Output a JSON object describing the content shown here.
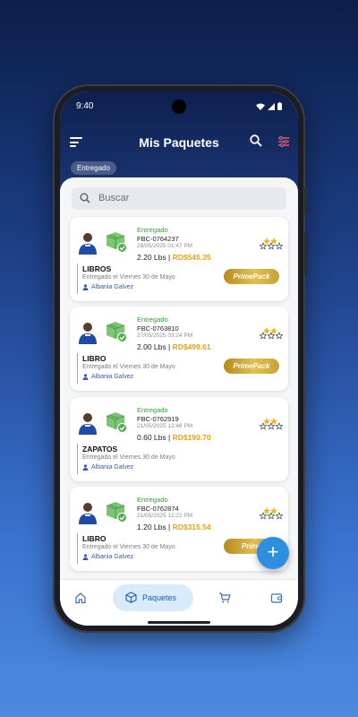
{
  "status_bar": {
    "time": "9:40"
  },
  "app_bar": {
    "title": "Mis Paquetes"
  },
  "filter_chip": {
    "label": "Entregado"
  },
  "search": {
    "placeholder": "Buscar"
  },
  "packages": [
    {
      "status": "Entregado",
      "code": "FBC-0764237",
      "date": "28/05/2025 01:47 PM",
      "weight": "2.20 Lbs",
      "price": "RD$545.35",
      "category": "LIBROS",
      "delivered_text": "Entregado el Viernes 30 de Mayo",
      "recipient": "Albania Galvez",
      "badge": "PrimePack"
    },
    {
      "status": "Entregado",
      "code": "FBC-0763810",
      "date": "27/05/2025 03:24 PM",
      "weight": "2.00 Lbs",
      "price": "RD$499.61",
      "category": "LIBRO",
      "delivered_text": "Entregado el Viernes 30 de Mayo",
      "recipient": "Albania Galvez",
      "badge": "PrimePack"
    },
    {
      "status": "Entregado",
      "code": "FBC-0762919",
      "date": "21/05/2025 12:46 PM",
      "weight": "0.60 Lbs",
      "price": "RD$190.70",
      "category": "ZAPATOS",
      "delivered_text": "Entregado el Viernes 30 de Mayo",
      "recipient": "Albania Galvez",
      "badge": ""
    },
    {
      "status": "Entregado",
      "code": "FBC-0762874",
      "date": "21/05/2025 12:22 PM",
      "weight": "1.20 Lbs",
      "price": "RD$315.54",
      "category": "LIBRO",
      "delivered_text": "Entregado el Viernes 30 de Mayo",
      "recipient": "Albania Galvez",
      "badge": "Prime"
    }
  ],
  "bottom_nav": {
    "items": [
      {
        "icon": "home-icon",
        "label": ""
      },
      {
        "icon": "package-icon",
        "label": "Paquetes"
      },
      {
        "icon": "cart-icon",
        "label": ""
      },
      {
        "icon": "wallet-icon",
        "label": ""
      }
    ]
  },
  "fab": {
    "icon": "plus-icon"
  },
  "colors": {
    "accent": "#2d8fde",
    "price": "#e8a317",
    "status_green": "#3a9a3a",
    "header": "#0d1f4d"
  }
}
